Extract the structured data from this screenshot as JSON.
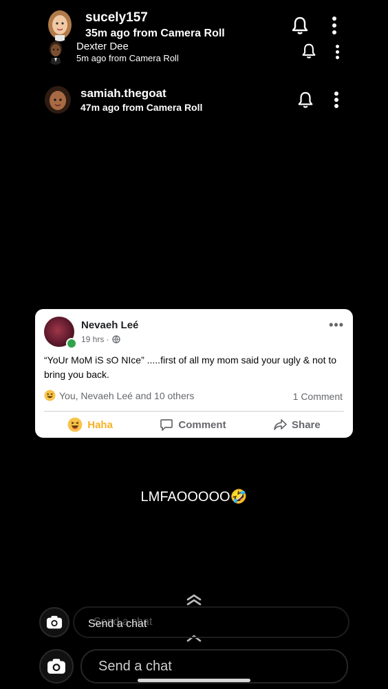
{
  "headers": [
    {
      "username": "sucely157",
      "subtitle": "35m ago from Camera Roll"
    },
    {
      "username": "Dexter Dee",
      "subtitle": "5m ago from Camera Roll"
    },
    {
      "username": "samiah.thegoat",
      "subtitle": "47m ago from Camera Roll"
    }
  ],
  "post": {
    "author": "Nevaeh Leé",
    "time": "19 hrs ·",
    "text": "“YoUr MoM iS sO NIce” .....first of all my mom said your ugly & not to bring you back.",
    "reactions": "You, Nevaeh Leé and 10 others",
    "comment_count": "1 Comment",
    "actions": {
      "haha": "Haha",
      "comment": "Comment",
      "share": "Share"
    },
    "more": "•••"
  },
  "caption": "LMFAOOOOO🤣",
  "chat": {
    "overlay_placeholder": "Send a chat",
    "overlay_ghost": "Send a chat",
    "placeholder": "Send a chat"
  }
}
